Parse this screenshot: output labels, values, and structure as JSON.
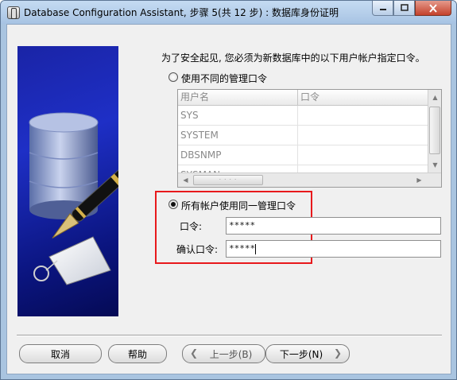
{
  "window": {
    "title": "Database Configuration Assistant, 步骤 5(共 12 步) : 数据库身份证明"
  },
  "intro_text": "为了安全起见, 您必须为新数据库中的以下用户帐户指定口令。",
  "option_different": {
    "label": "使用不同的管理口令",
    "selected": false
  },
  "accounts_table": {
    "columns": [
      "用户名",
      "口令"
    ],
    "rows": [
      {
        "user": "SYS",
        "password": ""
      },
      {
        "user": "SYSTEM",
        "password": ""
      },
      {
        "user": "DBSNMP",
        "password": ""
      },
      {
        "user": "SYSMAN",
        "password": ""
      }
    ],
    "disabled": true
  },
  "option_same": {
    "label": "所有帐户使用同一管理口令",
    "selected": true
  },
  "password": {
    "label": "口令:",
    "value": "*****"
  },
  "confirm_password": {
    "label": "确认口令:",
    "value": "*****"
  },
  "buttons": {
    "cancel": "取消",
    "help": "帮助",
    "back": "上一步(B)",
    "next": "下一步(N)"
  },
  "colors": {
    "highlight_border": "#e8191c",
    "wizard_image_bg": "#1a24a6"
  },
  "icons": {
    "wizard_illustration": "database-cylinder-with-fountain-pen"
  }
}
